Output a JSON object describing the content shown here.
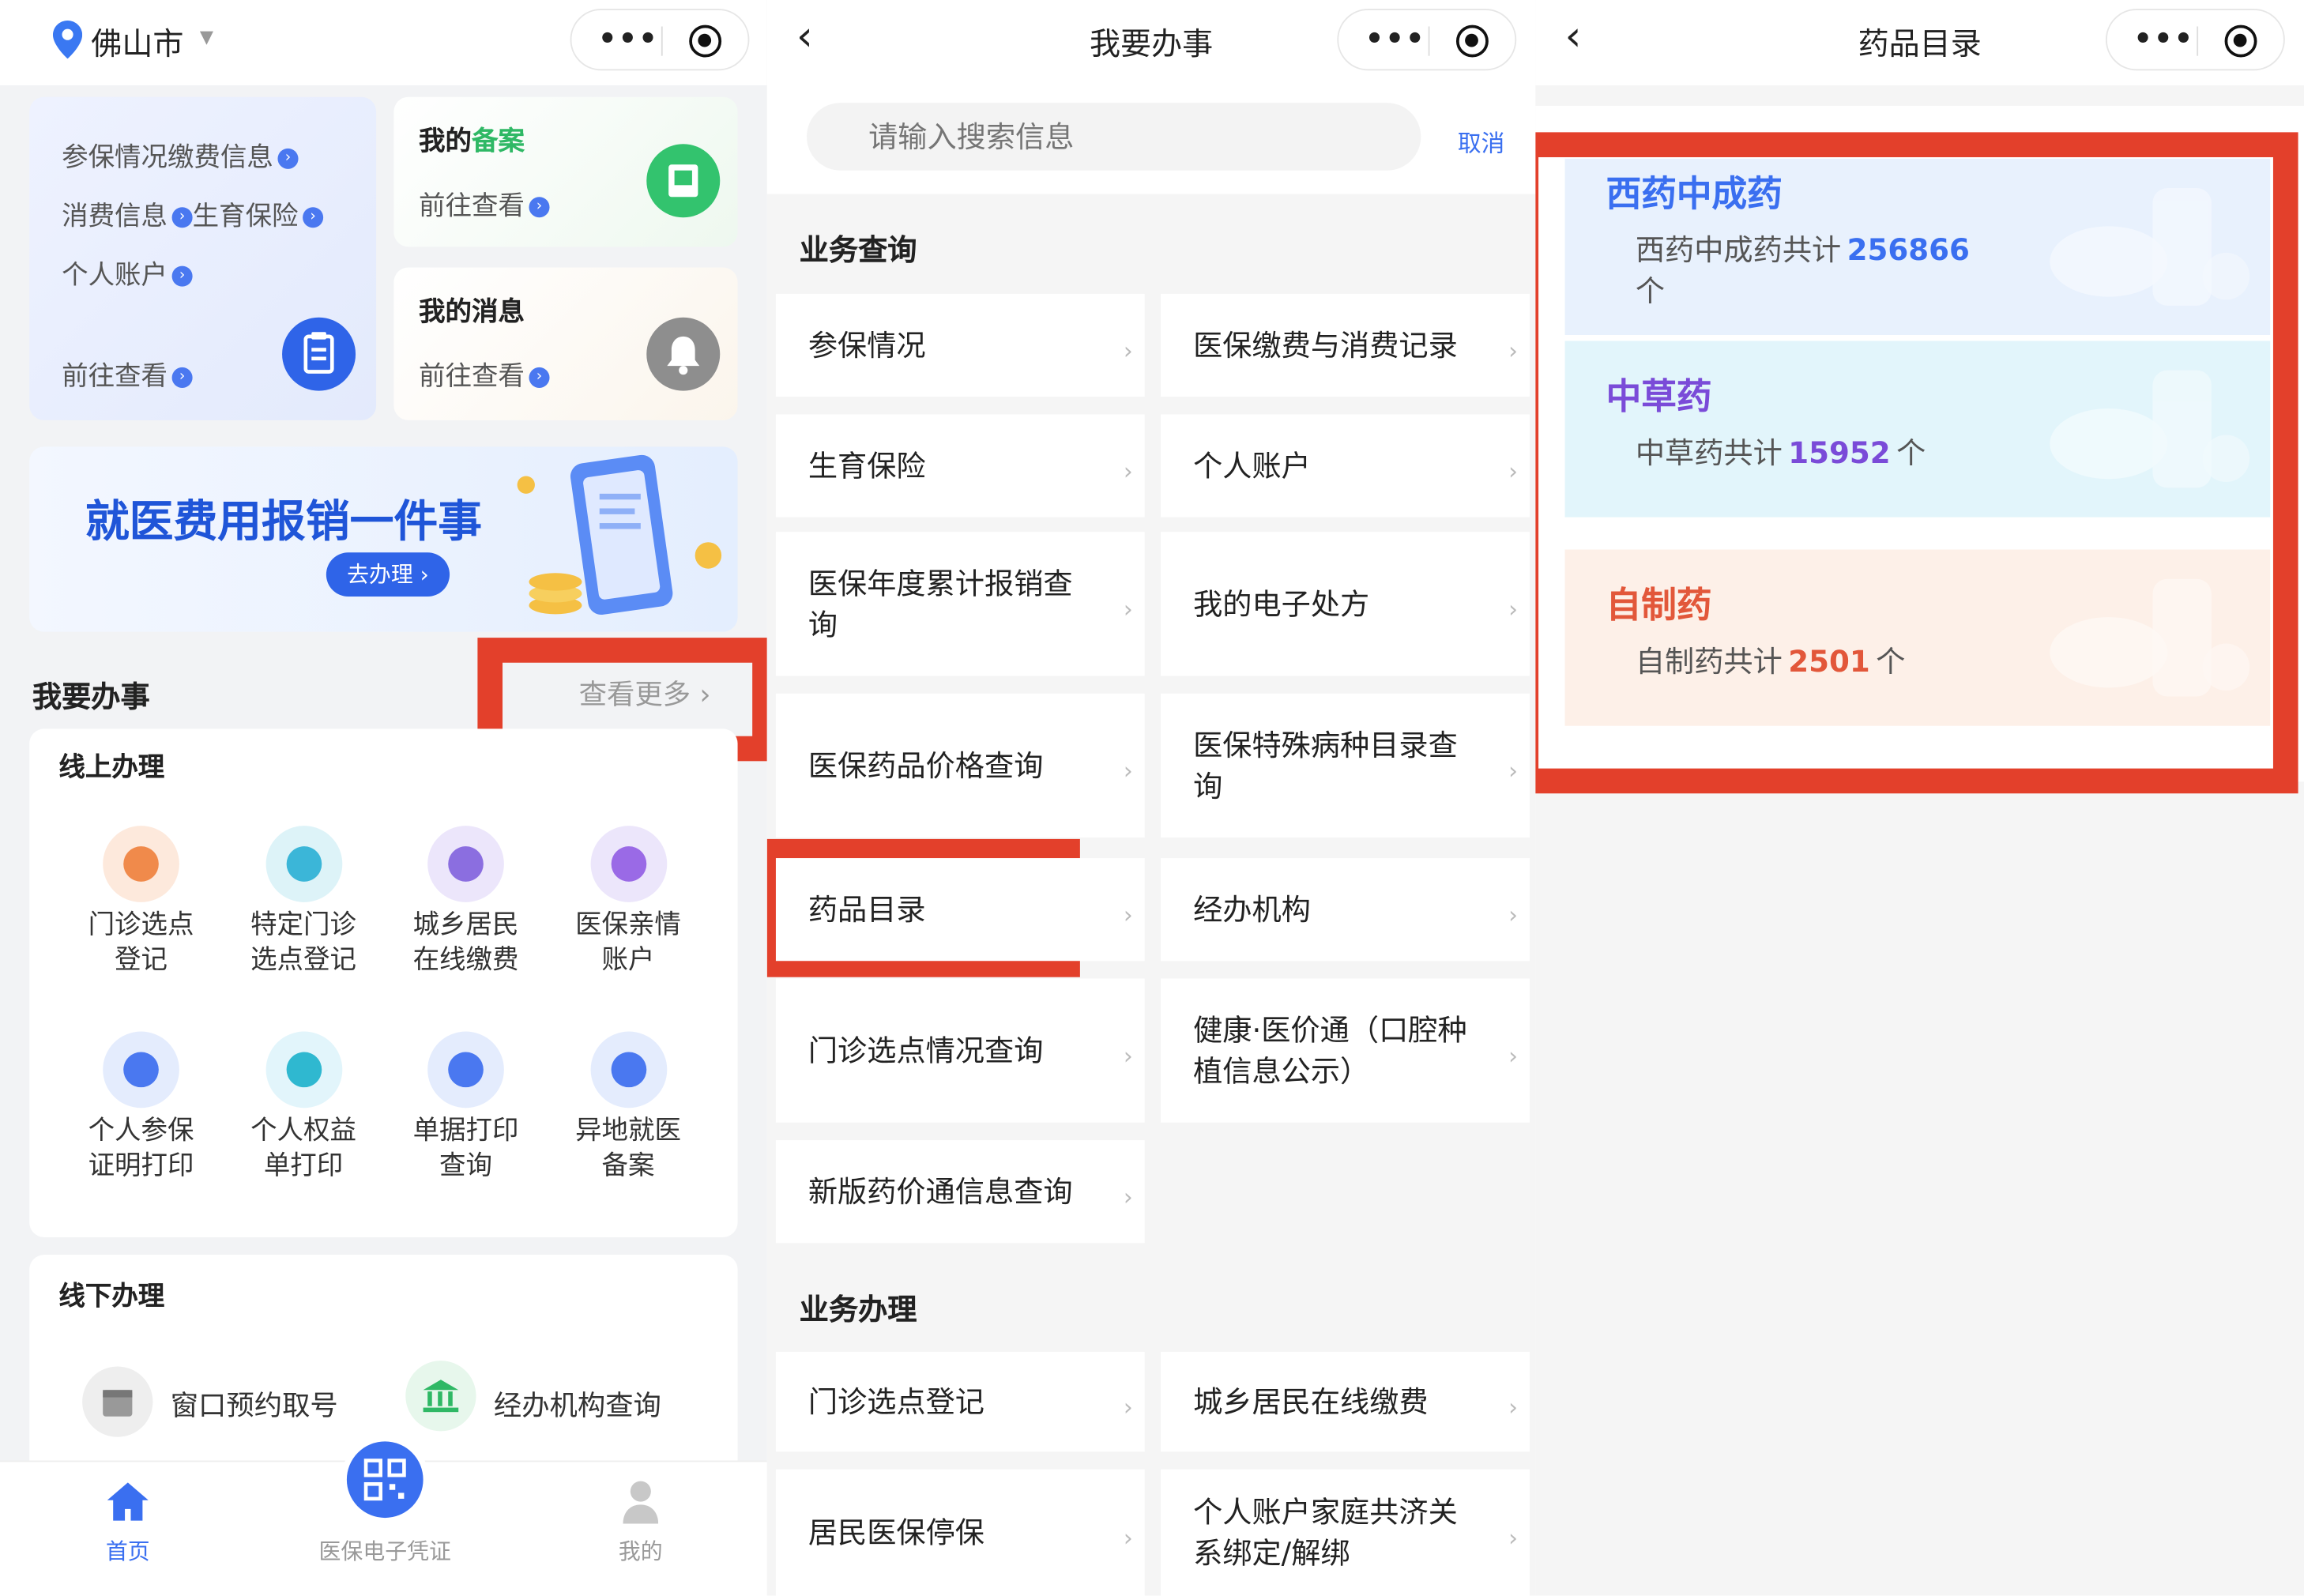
{
  "panel1": {
    "location": "佛山市",
    "quick": {
      "items": [
        "参保情况",
        "缴费信息",
        "消费信息",
        "生育保险",
        "个人账户"
      ],
      "go": "前往查看"
    },
    "filing": {
      "title_prefix": "我的",
      "title_accent": "备案",
      "go": "前往查看"
    },
    "messages": {
      "title": "我的消息",
      "go": "前往查看"
    },
    "banner": {
      "title": "就医费用报销一件事",
      "button": "去办理"
    },
    "section": {
      "title": "我要办事",
      "more": "查看更多"
    },
    "online": {
      "title": "线上办理",
      "items": [
        [
          "门诊选点",
          "登记"
        ],
        [
          "特定门诊",
          "选点登记"
        ],
        [
          "城乡居民",
          "在线缴费"
        ],
        [
          "医保亲情",
          "账户"
        ],
        [
          "个人参保",
          "证明打印"
        ],
        [
          "个人权益",
          "单打印"
        ],
        [
          "单据打印",
          "查询"
        ],
        [
          "异地就医",
          "备案"
        ]
      ]
    },
    "offline": {
      "title": "线下办理",
      "items": [
        "窗口预约取号",
        "经办机构查询"
      ]
    },
    "nav": {
      "home": "首页",
      "card": "医保电子凭证",
      "mine": "我的"
    },
    "colors": {
      "accent": "#3a6ff0",
      "highlight": "#e3402b"
    }
  },
  "panel2": {
    "title": "我要办事",
    "search_placeholder": "请输入搜索信息",
    "cancel": "取消",
    "query_title": "业务查询",
    "query": [
      "参保情况",
      "医保缴费与消费记录",
      "生育保险",
      "个人账户",
      "医保年度累计报销查询",
      "我的电子处方",
      "医保药品价格查询",
      "医保特殊病种目录查询",
      "药品目录",
      "经办机构",
      "门诊选点情况查询",
      "健康·医价通（口腔种植信息公示）",
      "新版药价通信息查询"
    ],
    "handle_title": "业务办理",
    "handle": [
      "门诊选点登记",
      "城乡居民在线缴费",
      "居民医保停保",
      "个人账户家庭共济关系绑定/解绑"
    ]
  },
  "panel3": {
    "title": "药品目录",
    "cats": [
      {
        "name": "西药中成药",
        "desc": "西药中成药共计",
        "count": "256866",
        "unit": "个",
        "color": "#3a6ff0",
        "bg": "#e8f1fd"
      },
      {
        "name": "中草药",
        "desc": "中草药共计",
        "count": "15952",
        "unit": "个",
        "color": "#7a4bd8",
        "bg": "#e2f5fb"
      },
      {
        "name": "自制药",
        "desc": "自制药共计",
        "count": "2501",
        "unit": "个",
        "color": "#e2573a",
        "bg": "#fdf0e8"
      }
    ]
  }
}
